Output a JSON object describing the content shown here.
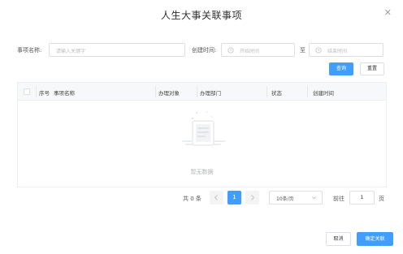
{
  "dialog": {
    "title": "人生大事关联事项",
    "close_icon": "close-icon"
  },
  "filters": {
    "item_name_label": "事项名称:",
    "item_name_placeholder": "请输入关键字",
    "created_time_label": "创建时间:",
    "start_placeholder": "开始时间",
    "range_separator": "至",
    "end_placeholder": "结束时间",
    "calendar_icon": "clock-icon"
  },
  "actions": {
    "query_label": "查询",
    "reset_label": "重置"
  },
  "table": {
    "columns": [
      "序号",
      "事项名称",
      "办理对象",
      "办理部门",
      "状态",
      "创建时间"
    ],
    "rows": [],
    "empty_text": "暂无数据"
  },
  "pagination": {
    "total_text": "共 0 条",
    "current_page": "1",
    "page_size": "10条/页",
    "goto_label": "前往",
    "goto_value": "1",
    "page_suffix": "页"
  },
  "footer": {
    "cancel_label": "取消",
    "confirm_label": "确定关联"
  },
  "colors": {
    "primary": "#409eff",
    "border": "#dcdfe6",
    "header_bg": "#f7f8fa"
  }
}
